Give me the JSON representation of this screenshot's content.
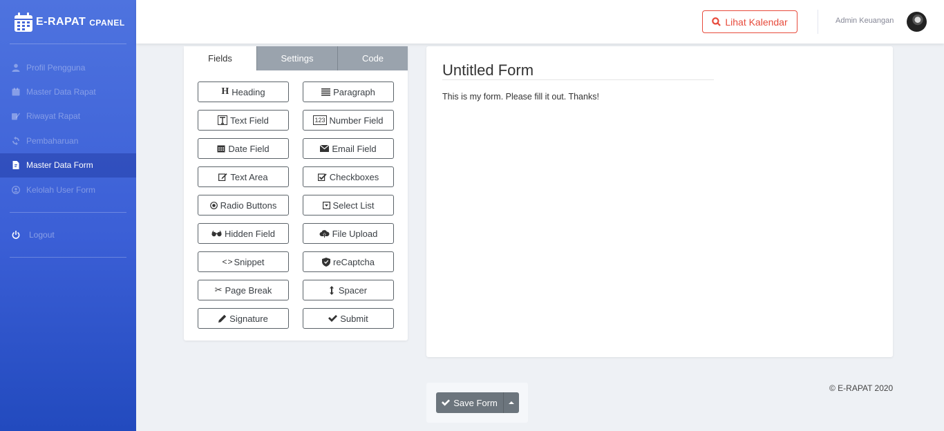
{
  "brand": {
    "name": "E-RAPAT",
    "sub": "CPANEL"
  },
  "sidebar": {
    "items": [
      {
        "label": "Profil Pengguna",
        "icon": "user-icon"
      },
      {
        "label": "Master Data Rapat",
        "icon": "calendar-icon"
      },
      {
        "label": "Riwayat Rapat",
        "icon": "edit-icon"
      },
      {
        "label": "Pembaharuan",
        "icon": "refresh-icon"
      },
      {
        "label": "Master Data Form",
        "icon": "file-icon",
        "active": true
      },
      {
        "label": "Kelolah User Form",
        "icon": "user-circle-icon"
      }
    ],
    "logout": "Logout"
  },
  "topbar": {
    "calendar_button": "Lihat Kalendar",
    "user_name": "Admin Keuangan"
  },
  "builder": {
    "tabs": [
      "Fields",
      "Settings",
      "Code"
    ],
    "fields": [
      "Heading",
      "Paragraph",
      "Text Field",
      "Number Field",
      "Date Field",
      "Email Field",
      "Text Area",
      "Checkboxes",
      "Radio Buttons",
      "Select List",
      "Hidden Field",
      "File Upload",
      "Snippet",
      "reCaptcha",
      "Page Break",
      "Spacer",
      "Signature",
      "Submit"
    ]
  },
  "form": {
    "title": "Untitled Form",
    "description": "This is my form. Please fill it out. Thanks!"
  },
  "save": {
    "label": "Save Form"
  },
  "footer": "© E-RAPAT 2020",
  "colors": {
    "sidebar": "#4e73df",
    "danger": "#e74a3b",
    "secondary": "#6c757d"
  }
}
